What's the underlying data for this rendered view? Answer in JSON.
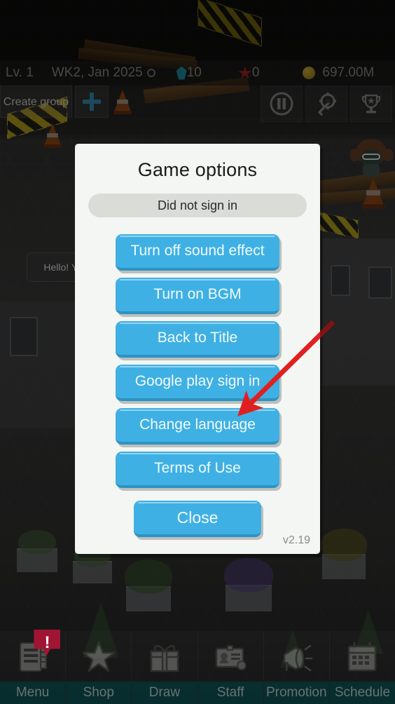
{
  "hud": {
    "level": "Lv. 1",
    "date": "WK2, Jan 2025",
    "clock_icon": "clock-icon",
    "gem_icon": "gem-icon",
    "gems": "10",
    "star_icon": "star-icon",
    "stars": "0",
    "coin_icon": "coin-icon",
    "money": "697.00M"
  },
  "toolbar": {
    "create_group_label": "Create group",
    "add_icon": "plus-icon",
    "pause_icon": "pause-icon",
    "settings_icon": "gear-wrench-icon",
    "trophy_icon": "trophy-icon"
  },
  "tooltip": {
    "text": "Hello! Yo informa touc"
  },
  "dialog": {
    "title": "Game options",
    "signin_status": "Did not sign in",
    "buttons": [
      {
        "label": "Turn off sound effect",
        "name": "turn-off-sound-effect-button"
      },
      {
        "label": "Turn on BGM",
        "name": "turn-on-bgm-button"
      },
      {
        "label": "Back to Title",
        "name": "back-to-title-button"
      },
      {
        "label": "Google play sign in",
        "name": "google-play-sign-in-button"
      },
      {
        "label": "Change language",
        "name": "change-language-button"
      },
      {
        "label": "Terms of Use",
        "name": "terms-of-use-button"
      }
    ],
    "close_label": "Close",
    "version": "v2.19",
    "button_color": "#3fb0e3",
    "panel_color": "#f3f6f2"
  },
  "annotation": {
    "arrow_color": "#e02020",
    "points_to": "Change language"
  },
  "bottom_nav": {
    "items": [
      {
        "label": "Menu",
        "icon": "document-list-icon",
        "badge": "!"
      },
      {
        "label": "Shop",
        "icon": "star-icon",
        "badge": ""
      },
      {
        "label": "Draw",
        "icon": "gift-box-icon",
        "badge": ""
      },
      {
        "label": "Staff",
        "icon": "id-card-icon",
        "badge": ""
      },
      {
        "label": "Promotion",
        "icon": "megaphone-icon",
        "badge": ""
      },
      {
        "label": "Schedule",
        "icon": "calendar-icon",
        "badge": ""
      }
    ],
    "label_bg": "#085a5c"
  }
}
